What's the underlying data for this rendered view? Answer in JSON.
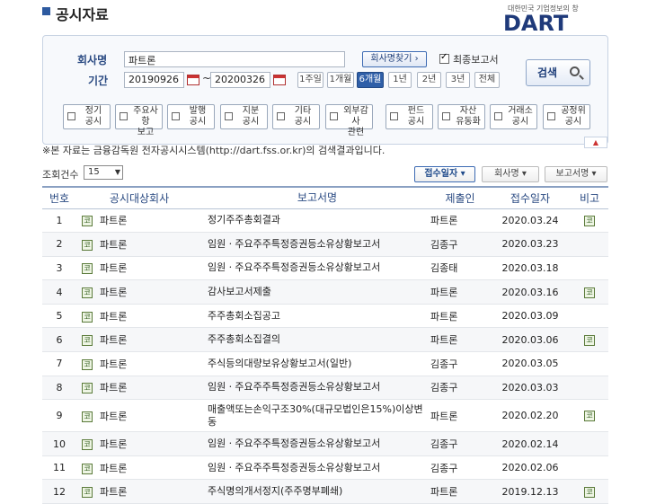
{
  "header": {
    "title": "공시자료",
    "logo_sub": "대한민국 기업정보의 창",
    "logo": "DART"
  },
  "search": {
    "company_label": "회사명",
    "company_value": "파트론",
    "find_company_label": "회사명찾기 ›",
    "final_report_label": "최종보고서",
    "final_report_checked": true,
    "period_label": "기간",
    "date_from": "20190926",
    "date_to": "20200326",
    "date_sep": "~",
    "periods": [
      "1주일",
      "1개월",
      "6개월",
      "1년",
      "2년",
      "3년",
      "전체"
    ],
    "active_period": "6개월",
    "search_button": "검색",
    "categories": [
      [
        "정기",
        "공시"
      ],
      [
        "주요사항",
        "보고"
      ],
      [
        "발행",
        "공시"
      ],
      [
        "지분",
        "공시"
      ],
      [
        "기타",
        "공시"
      ],
      [
        "외부감사",
        "관련"
      ],
      [
        "펀드",
        "공시"
      ],
      [
        "자산",
        "유동화"
      ],
      [
        "거래소",
        "공시"
      ],
      [
        "공정위",
        "공시"
      ]
    ],
    "collapse_icon": "▲"
  },
  "notice": "※본 자료는 금융감독원 전자공시시스템(http://dart.fss.or.kr)의 검색결과입니다.",
  "list_controls": {
    "count_label": "조회건수",
    "count_value": "15",
    "sort_buttons": [
      "접수일자 ▾",
      "회사명 ▾",
      "보고서명 ▾"
    ]
  },
  "table": {
    "headers": [
      "번호",
      "공시대상회사",
      "보고서명",
      "제출인",
      "접수일자",
      "비고"
    ],
    "rows": [
      {
        "no": "1",
        "company": "파트론",
        "report": "정기주주총회결과",
        "submitter": "파트론",
        "date": "2020.03.24",
        "note": "코"
      },
      {
        "no": "2",
        "company": "파트론",
        "report": "임원ㆍ주요주주특정증권등소유상황보고서",
        "submitter": "김종구",
        "date": "2020.03.23",
        "note": ""
      },
      {
        "no": "3",
        "company": "파트론",
        "report": "임원ㆍ주요주주특정증권등소유상황보고서",
        "submitter": "김종태",
        "date": "2020.03.18",
        "note": ""
      },
      {
        "no": "4",
        "company": "파트론",
        "report": "감사보고서제출",
        "submitter": "파트론",
        "date": "2020.03.16",
        "note": "코"
      },
      {
        "no": "5",
        "company": "파트론",
        "report": "주주총회소집공고",
        "submitter": "파트론",
        "date": "2020.03.09",
        "note": ""
      },
      {
        "no": "6",
        "company": "파트론",
        "report": "주주총회소집결의",
        "submitter": "파트론",
        "date": "2020.03.06",
        "note": "코"
      },
      {
        "no": "7",
        "company": "파트론",
        "report": "주식등의대량보유상황보고서(일반)",
        "submitter": "김종구",
        "date": "2020.03.05",
        "note": ""
      },
      {
        "no": "8",
        "company": "파트론",
        "report": "임원ㆍ주요주주특정증권등소유상황보고서",
        "submitter": "김종구",
        "date": "2020.03.03",
        "note": ""
      },
      {
        "no": "9",
        "company": "파트론",
        "report": "매출액또는손익구조30%(대규모법인은15%)이상변동",
        "submitter": "파트론",
        "date": "2020.02.20",
        "note": "코"
      },
      {
        "no": "10",
        "company": "파트론",
        "report": "임원ㆍ주요주주특정증권등소유상황보고서",
        "submitter": "김종구",
        "date": "2020.02.14",
        "note": ""
      },
      {
        "no": "11",
        "company": "파트론",
        "report": "임원ㆍ주요주주특정증권등소유상황보고서",
        "submitter": "김종구",
        "date": "2020.02.06",
        "note": ""
      },
      {
        "no": "12",
        "company": "파트론",
        "report": "주식명의개서정지(주주명부폐쇄)",
        "submitter": "파트론",
        "date": "2019.12.13",
        "note": "코"
      }
    ],
    "market_icon": "코"
  }
}
